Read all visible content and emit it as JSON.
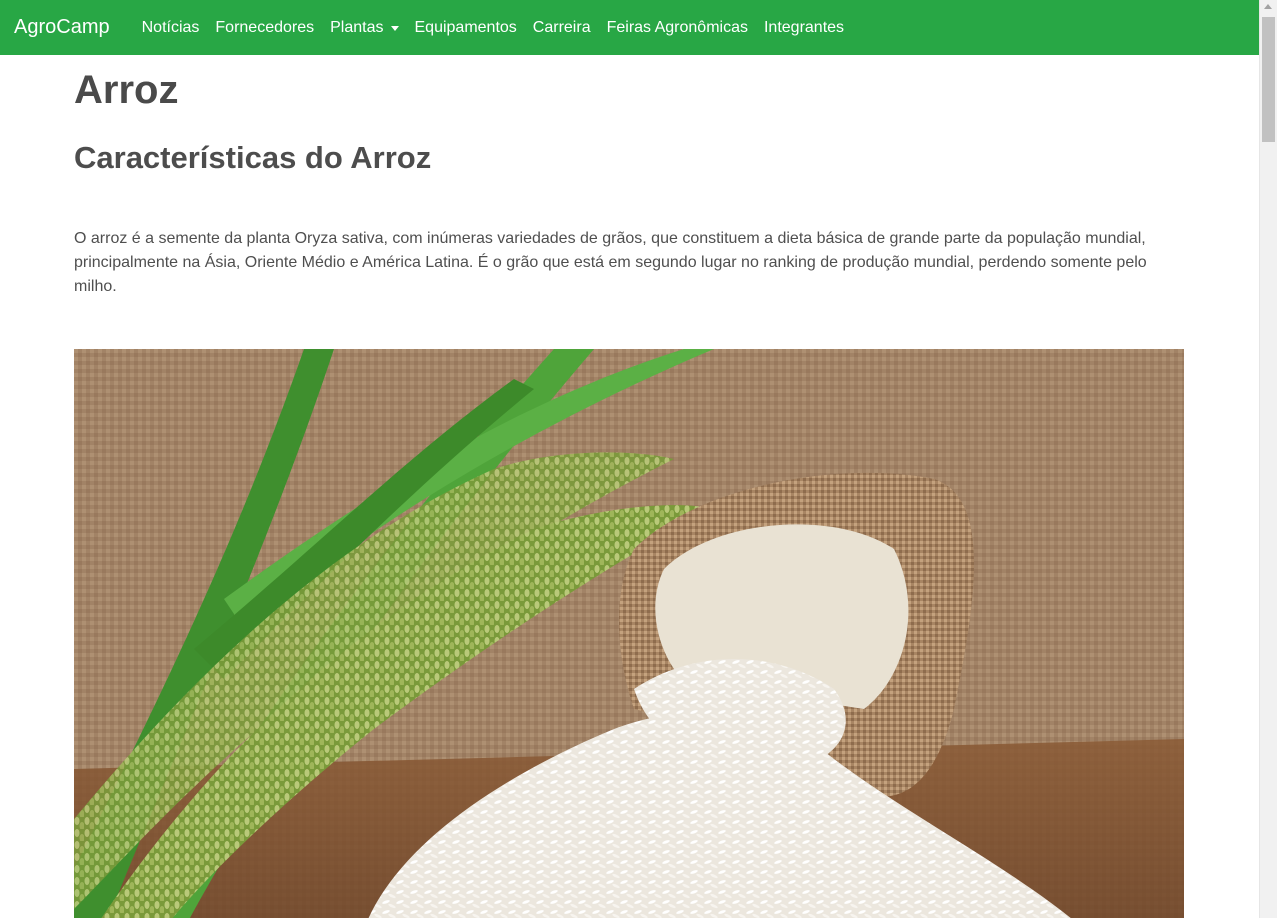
{
  "navbar": {
    "brand": "AgroCamp",
    "links": [
      {
        "label": "Notícias"
      },
      {
        "label": "Fornecedores"
      },
      {
        "label": "Plantas",
        "dropdown": true
      },
      {
        "label": "Equipamentos"
      },
      {
        "label": "Carreira"
      },
      {
        "label": "Feiras Agronômicas"
      },
      {
        "label": "Integrantes"
      }
    ],
    "color": "#28a745"
  },
  "main": {
    "title": "Arroz",
    "subtitle": "Características do Arroz",
    "description": "O arroz é a semente da planta Oryza sativa, com inúmeras variedades de grãos, que constituem a dieta básica de grande parte da população mundial, principalmente na Ásia, Oriente Médio e América Latina. É o grão que está em segundo lugar no ranking de produção mundial, perdendo somente pelo milho."
  }
}
